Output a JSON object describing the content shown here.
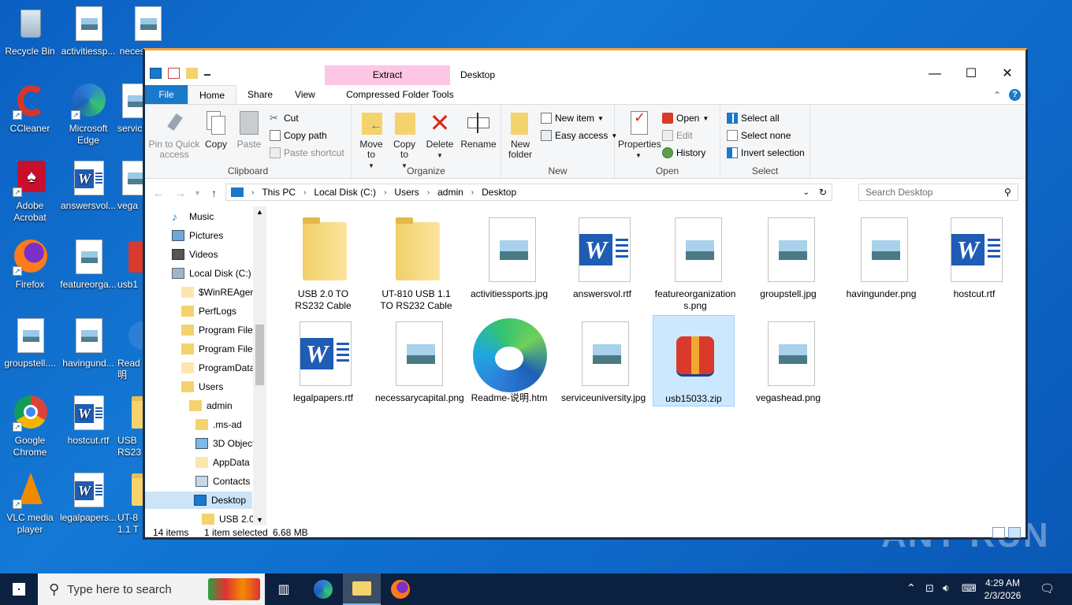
{
  "desktop": {
    "icons": [
      {
        "label": "Recycle Bin"
      },
      {
        "label": "activitiessp..."
      },
      {
        "label": "necessaryc..."
      },
      {
        "label": "CCleaner"
      },
      {
        "label": "Microsoft Edge"
      },
      {
        "label": "servic"
      },
      {
        "label": "Adobe Acrobat"
      },
      {
        "label": "answersvol..."
      },
      {
        "label": "vega"
      },
      {
        "label": "Firefox"
      },
      {
        "label": "featureorga..."
      },
      {
        "label": "usb1"
      },
      {
        "label": "groupstell...."
      },
      {
        "label": "havingund..."
      },
      {
        "label": "Read 明"
      },
      {
        "label": "Google Chrome"
      },
      {
        "label": "hostcut.rtf"
      },
      {
        "label": "USB RS23"
      },
      {
        "label": "VLC media player"
      },
      {
        "label": "legalpapers..."
      },
      {
        "label": "UT-8 1.1 T"
      }
    ],
    "watermark": "ANY RUN"
  },
  "window": {
    "title": "Desktop",
    "context_tab": "Extract",
    "tabs": [
      "File",
      "Home",
      "Share",
      "View",
      "Compressed Folder Tools"
    ],
    "ribbon": {
      "clipboard": {
        "name": "Clipboard",
        "pin": "Pin to Quick access",
        "copy": "Copy",
        "paste": "Paste",
        "cut": "Cut",
        "copy_path": "Copy path",
        "paste_shortcut": "Paste shortcut"
      },
      "organize": {
        "name": "Organize",
        "move_to": "Move to",
        "copy_to": "Copy to",
        "delete": "Delete",
        "rename": "Rename"
      },
      "new": {
        "name": "New",
        "new_folder": "New folder",
        "new_item": "New item",
        "easy_access": "Easy access"
      },
      "open": {
        "name": "Open",
        "properties": "Properties",
        "open": "Open",
        "edit": "Edit",
        "history": "History"
      },
      "select": {
        "name": "Select",
        "select_all": "Select all",
        "select_none": "Select none",
        "invert": "Invert selection"
      }
    },
    "address": {
      "crumbs": [
        "This PC",
        "Local Disk (C:)",
        "Users",
        "admin",
        "Desktop"
      ]
    },
    "search": {
      "placeholder": "Search Desktop"
    },
    "nav": [
      {
        "label": "Music"
      },
      {
        "label": "Pictures"
      },
      {
        "label": "Videos"
      },
      {
        "label": "Local Disk (C:)"
      },
      {
        "label": "$WinREAgent"
      },
      {
        "label": "PerfLogs"
      },
      {
        "label": "Program Files"
      },
      {
        "label": "Program Files"
      },
      {
        "label": "ProgramData"
      },
      {
        "label": "Users"
      },
      {
        "label": "admin"
      },
      {
        "label": ".ms-ad"
      },
      {
        "label": "3D Objects"
      },
      {
        "label": "AppData"
      },
      {
        "label": "Contacts"
      },
      {
        "label": "Desktop"
      },
      {
        "label": "USB 2.0 T"
      }
    ],
    "files": [
      {
        "name": "USB 2.0 TO RS232 Cable",
        "type": "folder"
      },
      {
        "name": "UT-810 USB 1.1 TO RS232 Cable",
        "type": "folder"
      },
      {
        "name": "activitiessports.jpg",
        "type": "image"
      },
      {
        "name": "answersvol.rtf",
        "type": "word"
      },
      {
        "name": "featureorganizations.png",
        "type": "image"
      },
      {
        "name": "groupstell.jpg",
        "type": "image"
      },
      {
        "name": "havingunder.png",
        "type": "image"
      },
      {
        "name": "hostcut.rtf",
        "type": "word"
      },
      {
        "name": "legalpapers.rtf",
        "type": "word"
      },
      {
        "name": "necessarycapital.png",
        "type": "image"
      },
      {
        "name": "Readme-说明.htm",
        "type": "edge"
      },
      {
        "name": "serviceuniversity.jpg",
        "type": "image"
      },
      {
        "name": "usb15033.zip",
        "type": "zip"
      },
      {
        "name": "vegashead.png",
        "type": "image"
      }
    ],
    "status": {
      "count": "14 items",
      "selected": "1 item selected",
      "size": "6.68 MB"
    }
  },
  "taskbar": {
    "search_placeholder": "Type here to search",
    "time": "4:29 AM",
    "date": "2/3/2026"
  },
  "colors": {
    "accent": "#1979ca",
    "context_tab": "#fcc6e4",
    "selection": "#cce8ff"
  }
}
